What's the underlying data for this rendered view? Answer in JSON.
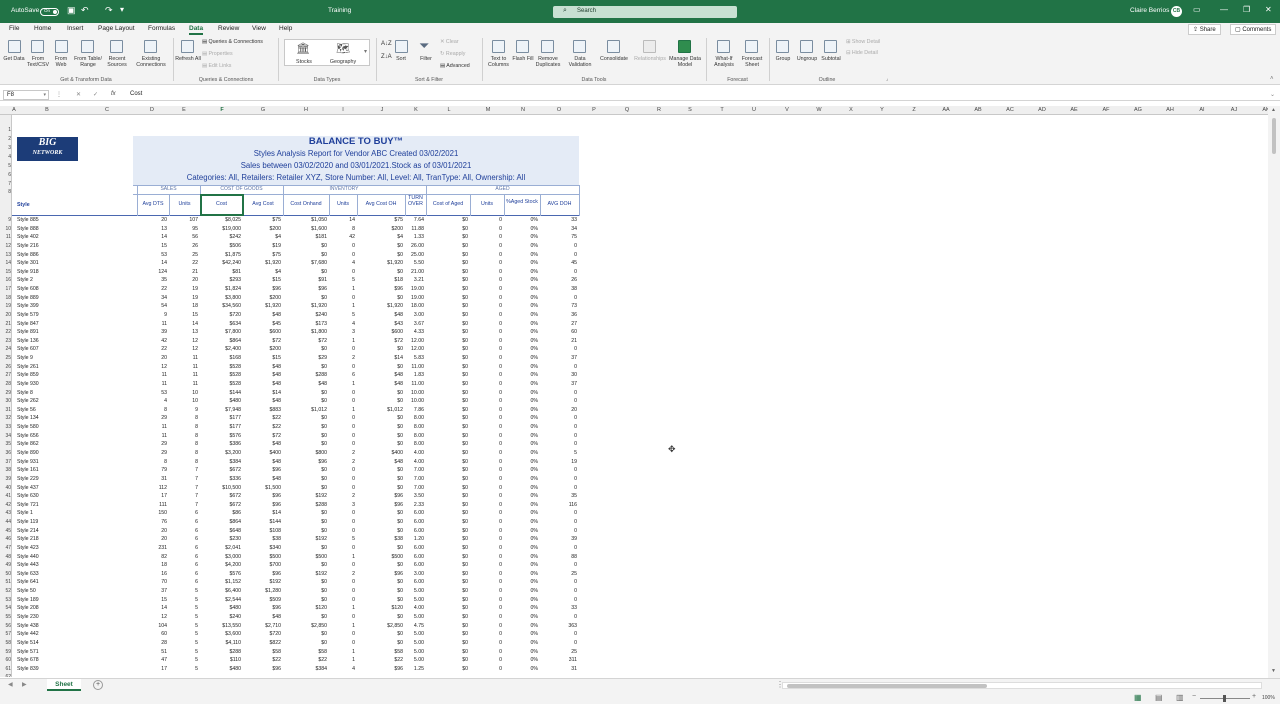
{
  "titlebar": {
    "autosave": "AutoSave",
    "autosave_state": "On",
    "document": "Training",
    "search": "Search",
    "user": "Claire Berrios",
    "initials": "CB"
  },
  "menu": {
    "tabs": [
      "File",
      "Home",
      "Insert",
      "Page Layout",
      "Formulas",
      "Data",
      "Review",
      "View",
      "Help"
    ],
    "active": "Data",
    "share": "Share",
    "comments": "Comments"
  },
  "ribbon": {
    "get_data": "Get Data",
    "from_text": "From Text/CSV",
    "from_web": "From Web",
    "from_table": "From Table/ Range",
    "recent_sources": "Recent Sources",
    "existing_connections": "Existing Connections",
    "refresh_all": "Refresh All",
    "queries_connections": "Queries & Connections",
    "properties": "Properties",
    "edit_links": "Edit Links",
    "stocks": "Stocks",
    "geography": "Geography",
    "sort": "Sort",
    "filter": "Filter",
    "clear": "Clear",
    "reapply": "Reapply",
    "advanced": "Advanced",
    "text_to_columns": "Text to Columns",
    "flash_fill": "Flash Fill",
    "remove_duplicates": "Remove Duplicates",
    "data_validation": "Data Validation",
    "consolidate": "Consolidate",
    "relationships": "Relationships",
    "manage_data_model": "Manage Data Model",
    "what_if": "What-If Analysis",
    "forecast_sheet": "Forecast Sheet",
    "group": "Group",
    "ungroup": "Ungroup",
    "subtotal": "Subtotal",
    "show_detail": "Show Detail",
    "hide_detail": "Hide Detail",
    "groups": [
      "Get & Transform Data",
      "Queries & Connections",
      "Data Types",
      "Sort & Filter",
      "Data Tools",
      "Forecast",
      "Outline"
    ]
  },
  "formula_bar": {
    "name_box": "F8",
    "fx": "fx",
    "value": "Cost"
  },
  "columns": [
    "A",
    "B",
    "C",
    "D",
    "E",
    "F",
    "G",
    "H",
    "I",
    "J",
    "K",
    "L",
    "M",
    "N",
    "O",
    "P",
    "Q",
    "R",
    "S",
    "T",
    "U",
    "V",
    "W",
    "X",
    "Y",
    "Z",
    "AA",
    "AB",
    "AC",
    "AD",
    "AE",
    "AF",
    "AG",
    "AH",
    "AI",
    "AJ",
    "AK"
  ],
  "report": {
    "logo_line1": "BIG",
    "logo_line2": "NETWORK",
    "title": "BALANCE TO BUY™",
    "line2": "Styles Analysis Report for Vendor ABC Created 03/02/2021",
    "line3": "Sales between 03/02/2020 and 03/01/2021.Stock as of 03/01/2021",
    "line4": "Categories: All, Retailers: Retailer XYZ, Store Number: All, Level: All, TranType: All, Ownership: All",
    "groups": {
      "sales": "SALES",
      "cogs": "COST OF GOODS",
      "inventory": "INVENTORY",
      "aged": "AGED"
    },
    "headers": {
      "style": "Style",
      "avg_dts": "Avg DTS",
      "units": "Units",
      "cost": "Cost",
      "avg_cost": "Avg Cost",
      "cost_onhand": "Cost Onhand",
      "inv_units": "Units",
      "avg_cost_oh": "Avg Cost OH",
      "turnover": "TURN OVER",
      "cost_aged": "Cost of Aged",
      "aged_units": "Units",
      "pct_aged": "%Aged Stock",
      "avg_doh": "AVG DOH"
    }
  },
  "rows": [
    [
      "Style 885",
      "20",
      "107",
      "$8,025",
      "$75",
      "$1,050",
      "14",
      "$75",
      "7.64",
      "$0",
      "0",
      "0%",
      "33"
    ],
    [
      "Style 888",
      "13",
      "95",
      "$19,000",
      "$200",
      "$1,600",
      "8",
      "$200",
      "11.88",
      "$0",
      "0",
      "0%",
      "34"
    ],
    [
      "Style 402",
      "14",
      "56",
      "$242",
      "$4",
      "$181",
      "42",
      "$4",
      "1.33",
      "$0",
      "0",
      "0%",
      "75"
    ],
    [
      "Style 216",
      "15",
      "26",
      "$506",
      "$19",
      "$0",
      "0",
      "$0",
      "26.00",
      "$0",
      "0",
      "0%",
      "0"
    ],
    [
      "Style 886",
      "53",
      "25",
      "$1,875",
      "$75",
      "$0",
      "0",
      "$0",
      "25.00",
      "$0",
      "0",
      "0%",
      "0"
    ],
    [
      "Style 301",
      "14",
      "22",
      "$42,240",
      "$1,920",
      "$7,680",
      "4",
      "$1,920",
      "5.50",
      "$0",
      "0",
      "0%",
      "45"
    ],
    [
      "Style 918",
      "124",
      "21",
      "$81",
      "$4",
      "$0",
      "0",
      "$0",
      "21.00",
      "$0",
      "0",
      "0%",
      "0"
    ],
    [
      "Style 2",
      "35",
      "20",
      "$293",
      "$15",
      "$91",
      "5",
      "$18",
      "3.21",
      "$0",
      "0",
      "0%",
      "26"
    ],
    [
      "Style 608",
      "22",
      "19",
      "$1,824",
      "$96",
      "$96",
      "1",
      "$96",
      "19.00",
      "$0",
      "0",
      "0%",
      "38"
    ],
    [
      "Style 889",
      "34",
      "19",
      "$3,800",
      "$200",
      "$0",
      "0",
      "$0",
      "19.00",
      "$0",
      "0",
      "0%",
      "0"
    ],
    [
      "Style 399",
      "54",
      "18",
      "$34,560",
      "$1,920",
      "$1,920",
      "1",
      "$1,920",
      "18.00",
      "$0",
      "0",
      "0%",
      "73"
    ],
    [
      "Style 579",
      "9",
      "15",
      "$720",
      "$48",
      "$240",
      "5",
      "$48",
      "3.00",
      "$0",
      "0",
      "0%",
      "36"
    ],
    [
      "Style 847",
      "11",
      "14",
      "$634",
      "$45",
      "$173",
      "4",
      "$43",
      "3.67",
      "$0",
      "0",
      "0%",
      "27"
    ],
    [
      "Style 891",
      "39",
      "13",
      "$7,800",
      "$600",
      "$1,800",
      "3",
      "$600",
      "4.33",
      "$0",
      "0",
      "0%",
      "60"
    ],
    [
      "Style 136",
      "42",
      "12",
      "$864",
      "$72",
      "$72",
      "1",
      "$72",
      "12.00",
      "$0",
      "0",
      "0%",
      "21"
    ],
    [
      "Style 607",
      "22",
      "12",
      "$2,400",
      "$200",
      "$0",
      "0",
      "$0",
      "12.00",
      "$0",
      "0",
      "0%",
      "0"
    ],
    [
      "Style 9",
      "20",
      "11",
      "$168",
      "$15",
      "$29",
      "2",
      "$14",
      "5.83",
      "$0",
      "0",
      "0%",
      "37"
    ],
    [
      "Style 261",
      "12",
      "11",
      "$528",
      "$48",
      "$0",
      "0",
      "$0",
      "11.00",
      "$0",
      "0",
      "0%",
      "0"
    ],
    [
      "Style 859",
      "11",
      "11",
      "$528",
      "$48",
      "$288",
      "6",
      "$48",
      "1.83",
      "$0",
      "0",
      "0%",
      "30"
    ],
    [
      "Style 930",
      "11",
      "11",
      "$528",
      "$48",
      "$48",
      "1",
      "$48",
      "11.00",
      "$0",
      "0",
      "0%",
      "37"
    ],
    [
      "Style 8",
      "53",
      "10",
      "$144",
      "$14",
      "$0",
      "0",
      "$0",
      "10.00",
      "$0",
      "0",
      "0%",
      "0"
    ],
    [
      "Style 262",
      "4",
      "10",
      "$480",
      "$48",
      "$0",
      "0",
      "$0",
      "10.00",
      "$0",
      "0",
      "0%",
      "0"
    ],
    [
      "Style 56",
      "8",
      "9",
      "$7,948",
      "$883",
      "$1,012",
      "1",
      "$1,012",
      "7.86",
      "$0",
      "0",
      "0%",
      "20"
    ],
    [
      "Style 134",
      "29",
      "8",
      "$177",
      "$22",
      "$0",
      "0",
      "$0",
      "8.00",
      "$0",
      "0",
      "0%",
      "0"
    ],
    [
      "Style 580",
      "11",
      "8",
      "$177",
      "$22",
      "$0",
      "0",
      "$0",
      "8.00",
      "$0",
      "0",
      "0%",
      "0"
    ],
    [
      "Style 656",
      "11",
      "8",
      "$576",
      "$72",
      "$0",
      "0",
      "$0",
      "8.00",
      "$0",
      "0",
      "0%",
      "0"
    ],
    [
      "Style 862",
      "29",
      "8",
      "$386",
      "$48",
      "$0",
      "0",
      "$0",
      "8.00",
      "$0",
      "0",
      "0%",
      "0"
    ],
    [
      "Style 890",
      "29",
      "8",
      "$3,200",
      "$400",
      "$800",
      "2",
      "$400",
      "4.00",
      "$0",
      "0",
      "0%",
      "5"
    ],
    [
      "Style 931",
      "8",
      "8",
      "$384",
      "$48",
      "$96",
      "2",
      "$48",
      "4.00",
      "$0",
      "0",
      "0%",
      "19"
    ],
    [
      "Style 161",
      "79",
      "7",
      "$672",
      "$96",
      "$0",
      "0",
      "$0",
      "7.00",
      "$0",
      "0",
      "0%",
      "0"
    ],
    [
      "Style 229",
      "31",
      "7",
      "$336",
      "$48",
      "$0",
      "0",
      "$0",
      "7.00",
      "$0",
      "0",
      "0%",
      "0"
    ],
    [
      "Style 437",
      "112",
      "7",
      "$10,500",
      "$1,500",
      "$0",
      "0",
      "$0",
      "7.00",
      "$0",
      "0",
      "0%",
      "0"
    ],
    [
      "Style 630",
      "17",
      "7",
      "$672",
      "$96",
      "$192",
      "2",
      "$96",
      "3.50",
      "$0",
      "0",
      "0%",
      "35"
    ],
    [
      "Style 721",
      "111",
      "7",
      "$672",
      "$96",
      "$288",
      "3",
      "$96",
      "2.33",
      "$0",
      "0",
      "0%",
      "116"
    ],
    [
      "Style 1",
      "150",
      "6",
      "$86",
      "$14",
      "$0",
      "0",
      "$0",
      "6.00",
      "$0",
      "0",
      "0%",
      "0"
    ],
    [
      "Style 119",
      "76",
      "6",
      "$864",
      "$144",
      "$0",
      "0",
      "$0",
      "6.00",
      "$0",
      "0",
      "0%",
      "0"
    ],
    [
      "Style 214",
      "20",
      "6",
      "$648",
      "$108",
      "$0",
      "0",
      "$0",
      "6.00",
      "$0",
      "0",
      "0%",
      "0"
    ],
    [
      "Style 218",
      "20",
      "6",
      "$230",
      "$38",
      "$192",
      "5",
      "$38",
      "1.20",
      "$0",
      "0",
      "0%",
      "39"
    ],
    [
      "Style 423",
      "231",
      "6",
      "$2,041",
      "$340",
      "$0",
      "0",
      "$0",
      "6.00",
      "$0",
      "0",
      "0%",
      "0"
    ],
    [
      "Style 440",
      "82",
      "6",
      "$3,000",
      "$500",
      "$500",
      "1",
      "$500",
      "6.00",
      "$0",
      "0",
      "0%",
      "88"
    ],
    [
      "Style 443",
      "18",
      "6",
      "$4,200",
      "$700",
      "$0",
      "0",
      "$0",
      "6.00",
      "$0",
      "0",
      "0%",
      "0"
    ],
    [
      "Style 633",
      "16",
      "6",
      "$576",
      "$96",
      "$192",
      "2",
      "$96",
      "3.00",
      "$0",
      "0",
      "0%",
      "25"
    ],
    [
      "Style 641",
      "70",
      "6",
      "$1,152",
      "$192",
      "$0",
      "0",
      "$0",
      "6.00",
      "$0",
      "0",
      "0%",
      "0"
    ],
    [
      "Style 50",
      "37",
      "5",
      "$6,400",
      "$1,280",
      "$0",
      "0",
      "$0",
      "5.00",
      "$0",
      "0",
      "0%",
      "0"
    ],
    [
      "Style 189",
      "15",
      "5",
      "$2,544",
      "$509",
      "$0",
      "0",
      "$0",
      "5.00",
      "$0",
      "0",
      "0%",
      "0"
    ],
    [
      "Style 208",
      "14",
      "5",
      "$480",
      "$96",
      "$120",
      "1",
      "$120",
      "4.00",
      "$0",
      "0",
      "0%",
      "33"
    ],
    [
      "Style 230",
      "12",
      "5",
      "$240",
      "$48",
      "$0",
      "0",
      "$0",
      "5.00",
      "$0",
      "0",
      "0%",
      "0"
    ],
    [
      "Style 438",
      "104",
      "5",
      "$13,550",
      "$2,710",
      "$2,850",
      "1",
      "$2,850",
      "4.75",
      "$0",
      "0",
      "0%",
      "363"
    ],
    [
      "Style 442",
      "60",
      "5",
      "$3,600",
      "$720",
      "$0",
      "0",
      "$0",
      "5.00",
      "$0",
      "0",
      "0%",
      "0"
    ],
    [
      "Style 514",
      "28",
      "5",
      "$4,110",
      "$822",
      "$0",
      "0",
      "$0",
      "5.00",
      "$0",
      "0",
      "0%",
      "0"
    ],
    [
      "Style 571",
      "51",
      "5",
      "$288",
      "$58",
      "$58",
      "1",
      "$58",
      "5.00",
      "$0",
      "0",
      "0%",
      "25"
    ],
    [
      "Style 678",
      "47",
      "5",
      "$110",
      "$22",
      "$22",
      "1",
      "$22",
      "5.00",
      "$0",
      "0",
      "0%",
      "311"
    ],
    [
      "Style 839",
      "17",
      "5",
      "$480",
      "$96",
      "$384",
      "4",
      "$96",
      "1.25",
      "$0",
      "0",
      "0%",
      "31"
    ]
  ],
  "sheet_tab": "Sheet",
  "zoom": "100%"
}
